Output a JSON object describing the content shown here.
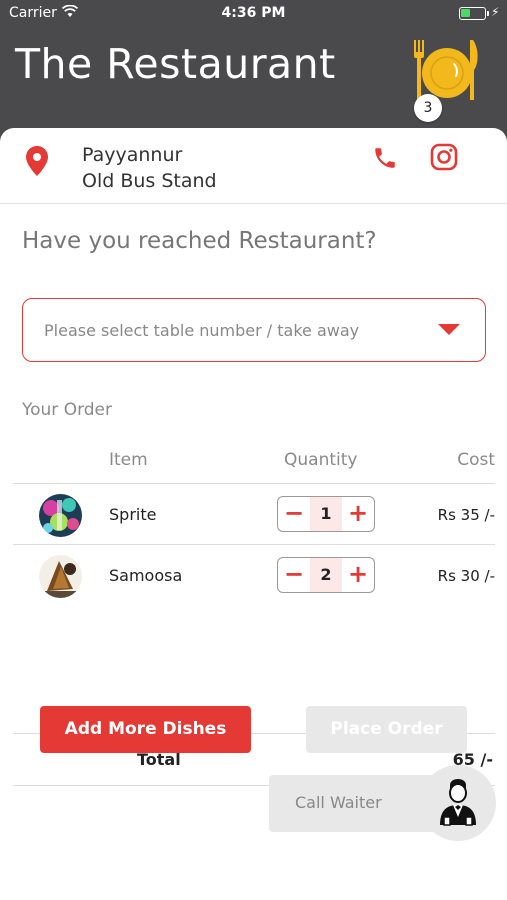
{
  "status_bar": {
    "carrier": "Carrier",
    "time": "4:36 PM",
    "battery_level": 0.4
  },
  "header": {
    "title": "The Restaurant",
    "cart_count": "3",
    "icon": "plate-fork-knife-icon",
    "icon_color": "#f2b81c",
    "background": "#4a4a4c"
  },
  "location": {
    "line1": "Payyannur",
    "line2": "Old Bus Stand",
    "icons": [
      "map-pin-icon",
      "phone-icon",
      "instagram-icon"
    ]
  },
  "question": "Have you reached Restaurant?",
  "table_select": {
    "placeholder": "Please select table number / take away"
  },
  "order": {
    "section_title": "Your Order",
    "columns": {
      "item": "Item",
      "quantity": "Quantity",
      "cost": "Cost"
    },
    "rows": [
      {
        "name": "Sprite",
        "quantity": "1",
        "cost": "Rs 35 /-",
        "minus": "−",
        "plus": "+"
      },
      {
        "name": "Samoosa",
        "quantity": "2",
        "cost": "Rs 30 /-",
        "minus": "−",
        "plus": "+"
      }
    ],
    "total_label": "Total",
    "total_value": "65 /-"
  },
  "actions": {
    "add_more": "Add More Dishes",
    "place_order": "Place Order",
    "call_waiter": "Call Waiter"
  },
  "colors": {
    "accent": "#e53935",
    "disabled": "#e8e8e8",
    "qty_highlight": "#fde8e8"
  }
}
